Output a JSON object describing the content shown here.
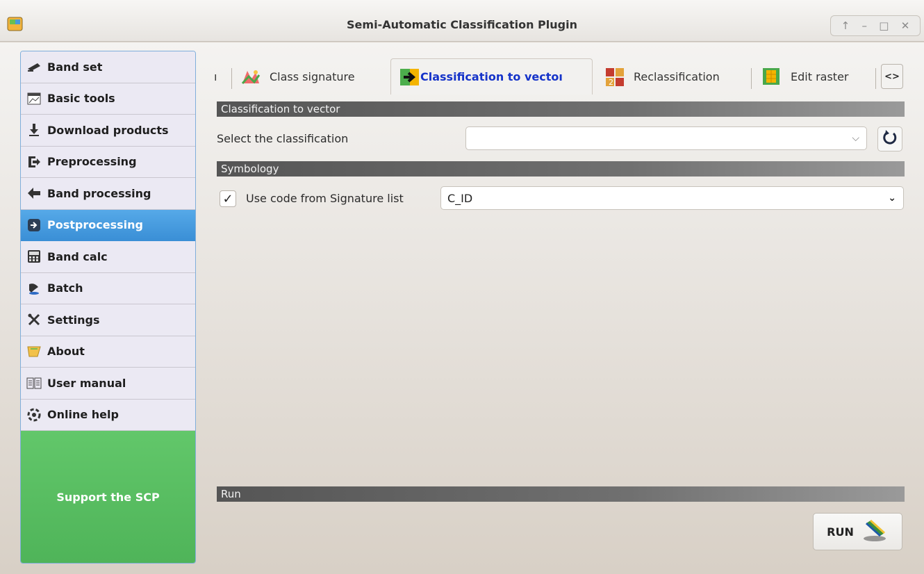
{
  "window": {
    "title": "Semi-Automatic Classification Plugin",
    "buttons": [
      "↑",
      "–",
      "□",
      "✕"
    ]
  },
  "sidebar": {
    "items": [
      {
        "label": "Band set",
        "icon": "pencil-icon"
      },
      {
        "label": "Basic tools",
        "icon": "basic-tools-icon"
      },
      {
        "label": "Download products",
        "icon": "download-icon"
      },
      {
        "label": "Preprocessing",
        "icon": "preprocessing-icon"
      },
      {
        "label": "Band processing",
        "icon": "band-processing-icon"
      },
      {
        "label": "Postprocessing",
        "icon": "postprocessing-icon",
        "active": true
      },
      {
        "label": "Band calc",
        "icon": "calculator-icon"
      },
      {
        "label": "Batch",
        "icon": "batch-icon"
      },
      {
        "label": "Settings",
        "icon": "settings-icon"
      },
      {
        "label": "About",
        "icon": "about-icon"
      },
      {
        "label": "User manual",
        "icon": "manual-icon"
      },
      {
        "label": "Online help",
        "icon": "help-icon"
      }
    ],
    "support_label": "Support the SCP"
  },
  "tabs": {
    "partial_left": "ı",
    "items": [
      {
        "label": "Class signature",
        "icon": "class-signature-icon"
      },
      {
        "label": "Classification to vector",
        "visible_label": "Classification to vectoı",
        "icon": "classification-to-vector-icon",
        "active": true
      },
      {
        "label": "Reclassification",
        "icon": "reclassification-icon"
      },
      {
        "label": "Edit raster",
        "icon": "edit-raster-icon"
      }
    ],
    "scroll_label": "<>"
  },
  "main": {
    "section_classification": "Classification to vector",
    "select_label": "Select the classification",
    "classification_value": "",
    "section_symbology": "Symbology",
    "use_code_label": "Use code from Signature list",
    "use_code_checked": true,
    "code_field_value": "C_ID",
    "section_run": "Run",
    "run_label": "RUN"
  },
  "colors": {
    "accent": "#3a8fd6",
    "support_green": "#58bd62",
    "active_tab_text": "#1533c9"
  }
}
